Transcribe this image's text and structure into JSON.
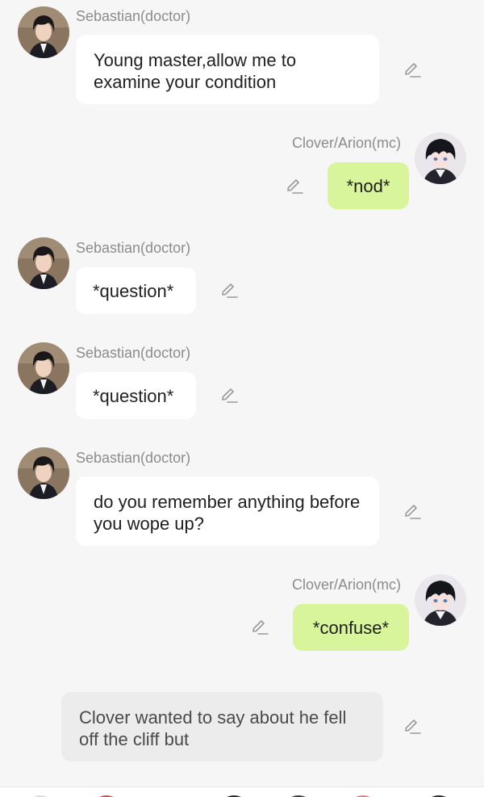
{
  "messages": [
    {
      "sender": "Sebastian(doctor)",
      "text": "Young master,allow me to examine your condition"
    },
    {
      "sender": "Clover/Arion(mc)",
      "text": "*nod*"
    },
    {
      "sender": "Sebastian(doctor)",
      "text": "*question*"
    },
    {
      "sender": "Sebastian(doctor)",
      "text": "*question*"
    },
    {
      "sender": "Sebastian(doctor)",
      "text": "do you remember anything before you wope up?"
    },
    {
      "sender": "Clover/Arion(mc)",
      "text": "*confuse*"
    },
    {
      "sender": "",
      "text": "Clover wanted to say about he fell off the cliff but"
    }
  ],
  "icons": {
    "edit": "pencil-edit-icon",
    "doctor_avatar": "sebastian-avatar",
    "mc_avatar": "clover-avatar"
  },
  "colors": {
    "background": "#f6f6f6",
    "bubble_other": "#ffffff",
    "bubble_user": "#d9f59b",
    "bubble_narration": "#ececec",
    "name_text": "#8c8c8c"
  }
}
